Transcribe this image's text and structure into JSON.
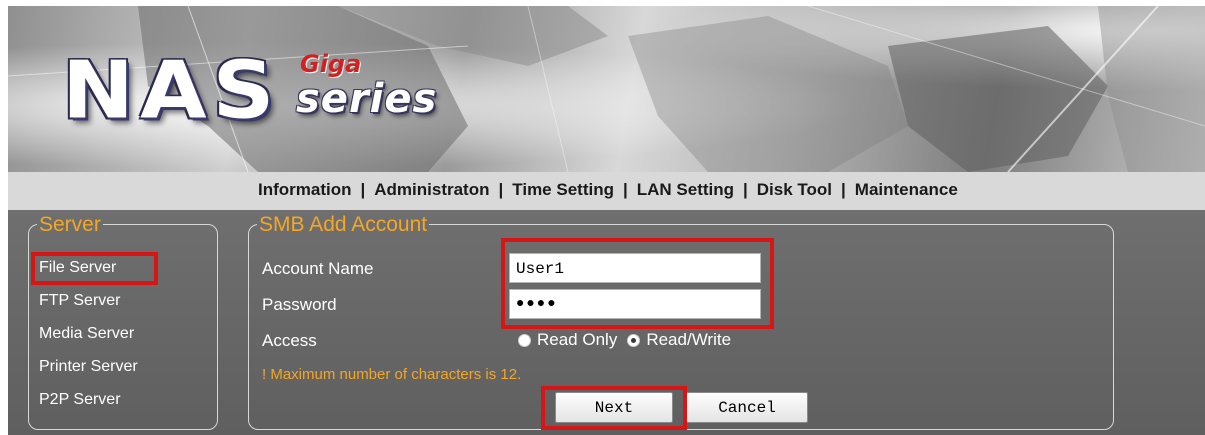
{
  "banner": {
    "logo_main": "NAS",
    "logo_giga": "Giga",
    "logo_series": "series"
  },
  "nav": {
    "items": [
      "Information",
      "Administraton",
      "Time Setting",
      "LAN Setting",
      "Disk Tool",
      "Maintenance"
    ],
    "separator": "|"
  },
  "sidebar": {
    "legend": "Server",
    "items": [
      "File Server",
      "FTP Server",
      "Media Server",
      "Printer Server",
      "P2P Server"
    ]
  },
  "form": {
    "legend": "SMB Add Account",
    "account_label": "Account Name",
    "account_value": "User1",
    "password_label": "Password",
    "password_value": "●●●●",
    "access_label": "Access",
    "access_options": [
      "Read Only",
      "Read/Write"
    ],
    "access_selected": "Read/Write",
    "warning": "! Maximum number of characters is 12.",
    "next_label": "Next",
    "cancel_label": "Cancel"
  },
  "colors": {
    "accent_orange": "#f5a623",
    "highlight_red": "#d81515",
    "panel_gray": "#666666"
  }
}
